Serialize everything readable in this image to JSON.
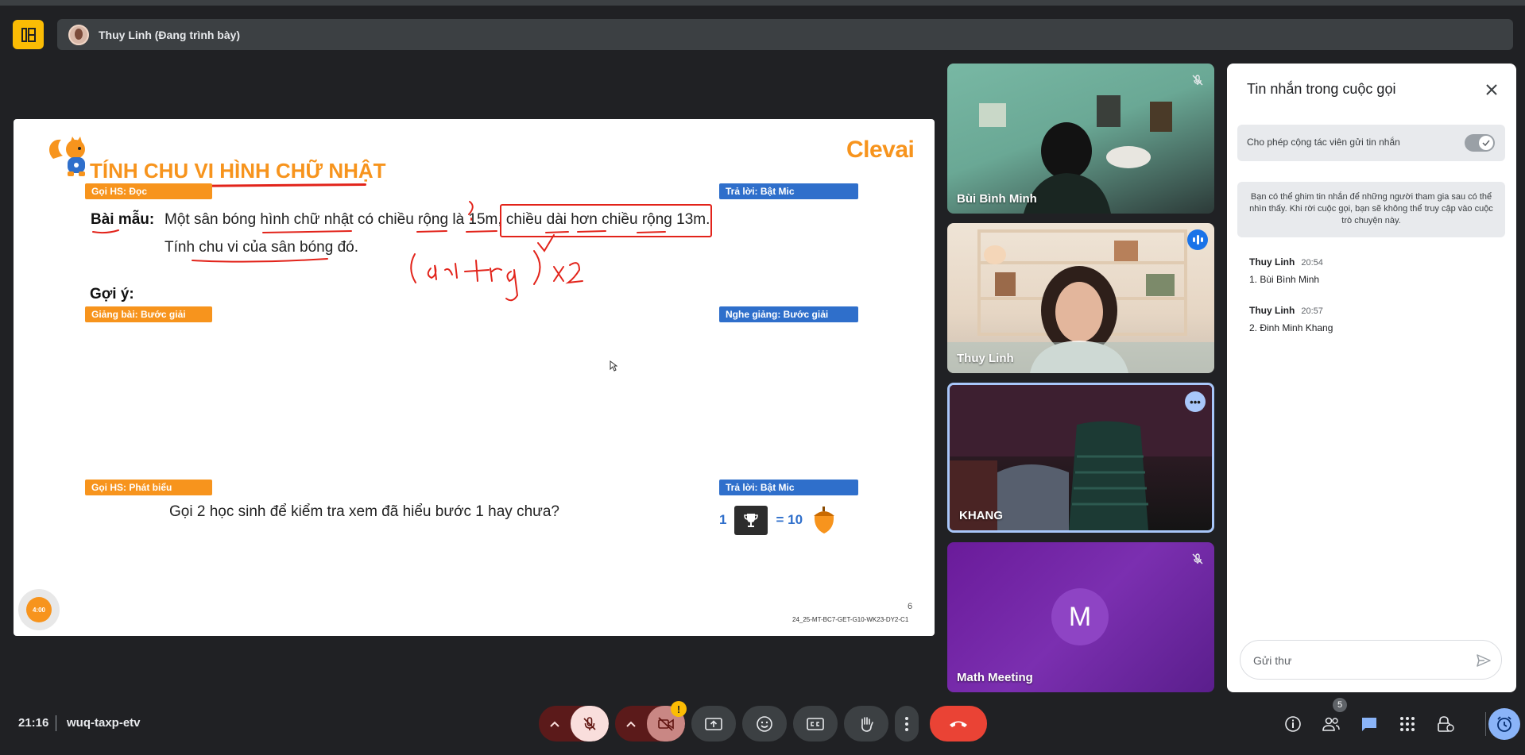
{
  "presenter": {
    "name": "Thuy Linh (Đang trình bày)"
  },
  "slide": {
    "title": "TÍNH CHU VI HÌNH CHỮ NHẬT",
    "brand": "Clevai",
    "tags": {
      "call_read": "Gọi HS: Đọc",
      "answer_mic_1": "Trả lời: Bật Mic",
      "teach_steps": "Giảng bài: Bước giải",
      "listen_steps": "Nghe giảng: Bước giải",
      "call_speak": "Gọi HS: Phát biểu",
      "answer_mic_2": "Trả lời: Bật Mic"
    },
    "example_label": "Bài mẫu:",
    "example_line1": "Một sân bóng hình chữ nhật có chiều rộng là 15m, chiều dài hơn chiều rộng 13m.",
    "example_line2": "Tính chu vi của sân bóng đó.",
    "hint_label": "Gợi ý:",
    "handwriting": "( dài + rộng ) x 2",
    "question": "Gọi 2 học sinh để kiểm tra xem đã hiểu bước 1 hay chưa?",
    "reward_left": "1",
    "reward_right": "= 10",
    "timer": "4:00",
    "page": "6",
    "code": "24_25-MT-BC7-GET-G10-WK23-DY2-C1"
  },
  "participants": [
    {
      "name": "Bùi Bình Minh",
      "muted": true
    },
    {
      "name": "Thuy Linh",
      "speaking": true
    },
    {
      "name": "KHANG",
      "pinned": true
    },
    {
      "name": "Math Meeting",
      "avatar_letter": "M",
      "muted": true
    }
  ],
  "chat": {
    "title": "Tin nhắn trong cuộc gọi",
    "toggle_label": "Cho phép cộng tác viên gửi tin nhắn",
    "toggle_on": true,
    "info": "Bạn có thể ghim tin nhắn để những người tham gia sau có thể nhìn thấy. Khi rời cuộc gọi, bạn sẽ không thể truy cập vào cuộc trò chuyện này.",
    "messages": [
      {
        "sender": "Thuy Linh",
        "time": "20:54",
        "text": "1. Bùi Bình Minh"
      },
      {
        "sender": "Thuy Linh",
        "time": "20:57",
        "text": "2. Đinh Minh Khang"
      }
    ],
    "input_placeholder": "Gửi thư"
  },
  "toolbar": {
    "time": "21:16",
    "meeting_code": "wuq-taxp-etv",
    "people_count": "5",
    "camera_warning": "!"
  },
  "colors": {
    "accent_orange": "#f7941d",
    "accent_blue": "#2f6fcb",
    "hangup_red": "#ea4335",
    "ink_red": "#e2231a"
  }
}
